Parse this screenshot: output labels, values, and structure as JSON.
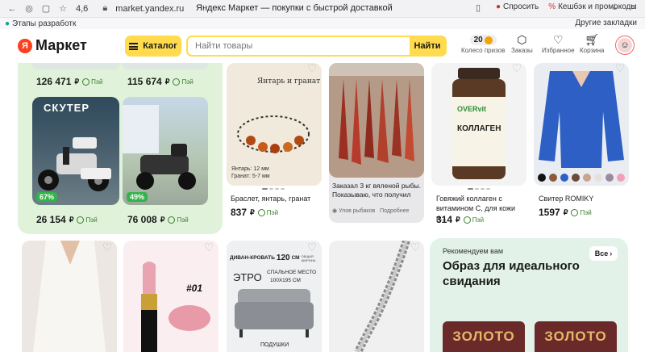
{
  "browser": {
    "rating": "4,6",
    "url": "market.yandex.ru",
    "tab_title": "Яндекс Маркет — покупки с быстрой доставкой",
    "ask_label": "Спросить",
    "cashback_label": "Кешбэк и промокоды",
    "bookmark_left": "Этапы разработк",
    "bookmark_right": "Другие закладки"
  },
  "header": {
    "logo_badge": "Я",
    "logo_text": "Маркет",
    "catalog_label": "Каталог",
    "search_placeholder": "Найти товары",
    "search_button": "Найти",
    "coins_count": "20",
    "nav": {
      "prizes": "Колесо призов",
      "orders": "Заказы",
      "favorites": "Избранное",
      "cart": "Корзина"
    }
  },
  "products": {
    "p1_price": "126 471",
    "p2_price": "115 674",
    "p3_price": "26 154",
    "p3_discount": "67%",
    "p3_banner": "СКУТЕР",
    "p4_price": "76 008",
    "p4_discount": "49%",
    "bracelet_title": "Браслет, янтарь, гранат",
    "bracelet_price": "837",
    "bracelet_banner": "Янтарь и гранат",
    "bracelet_spec1": "Янтарь: 12 мм",
    "bracelet_spec2": "Гранат: 5-7 мм",
    "fish_caption": "Заказал 3 кг вяленой рыбы. Показываю, что получил",
    "fish_author": "Улов рыбаков",
    "fish_more": "Подробнее",
    "collagen_title": "Говяжий коллаген с витамином С, для кожи и...",
    "collagen_price": "314",
    "collagen_brand": "OVERvit",
    "collagen_label": "КОЛЛАГЕН",
    "sweater_title": "Свитер ROMIKY",
    "sweater_price": "1597",
    "currency": "₽",
    "pay_label": "Пэй",
    "lipstick_label": "#01",
    "sofa_banner1": "ДИВАН-КРОВАТЬ",
    "sofa_size": "120",
    "sofa_unit": "СМ",
    "sofa_note": "ОБЩАЯ ШИРИНА",
    "sofa_name": "ЭТРО",
    "sofa_desc1": "СПАЛЬНОЕ МЕСТО",
    "sofa_desc2": "100Х195 СМ",
    "sofa_bottom": "ПОДУШКИ"
  },
  "promo": {
    "small": "Рекомендуем вам",
    "title": "Образ для идеального свидания",
    "button": "Все",
    "gold1": "ЗОЛОТО",
    "gold2": "ЗОЛОТО"
  }
}
